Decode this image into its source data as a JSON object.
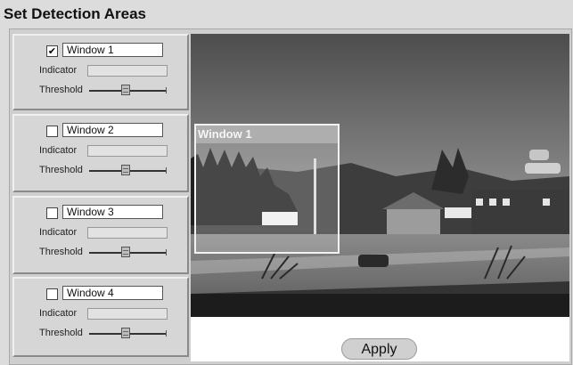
{
  "page": {
    "title": "Set Detection Areas"
  },
  "windows": [
    {
      "label": "Window 1",
      "checked": true,
      "check_mark": "✔",
      "indicator_label": "Indicator",
      "threshold_label": "Threshold"
    },
    {
      "label": "Window 2",
      "checked": false,
      "check_mark": "",
      "indicator_label": "Indicator",
      "threshold_label": "Threshold"
    },
    {
      "label": "Window 3",
      "checked": false,
      "check_mark": "",
      "indicator_label": "Indicator",
      "threshold_label": "Threshold"
    },
    {
      "label": "Window 4",
      "checked": false,
      "check_mark": "",
      "indicator_label": "Indicator",
      "threshold_label": "Threshold"
    }
  ],
  "video": {
    "overlay_title": "Window 1"
  },
  "apply_label": "Apply",
  "colors": {
    "panel_bg": "#d6d6d6",
    "frame_bg": "#cfcfcf",
    "overlay_border": "#f2f2f2"
  }
}
